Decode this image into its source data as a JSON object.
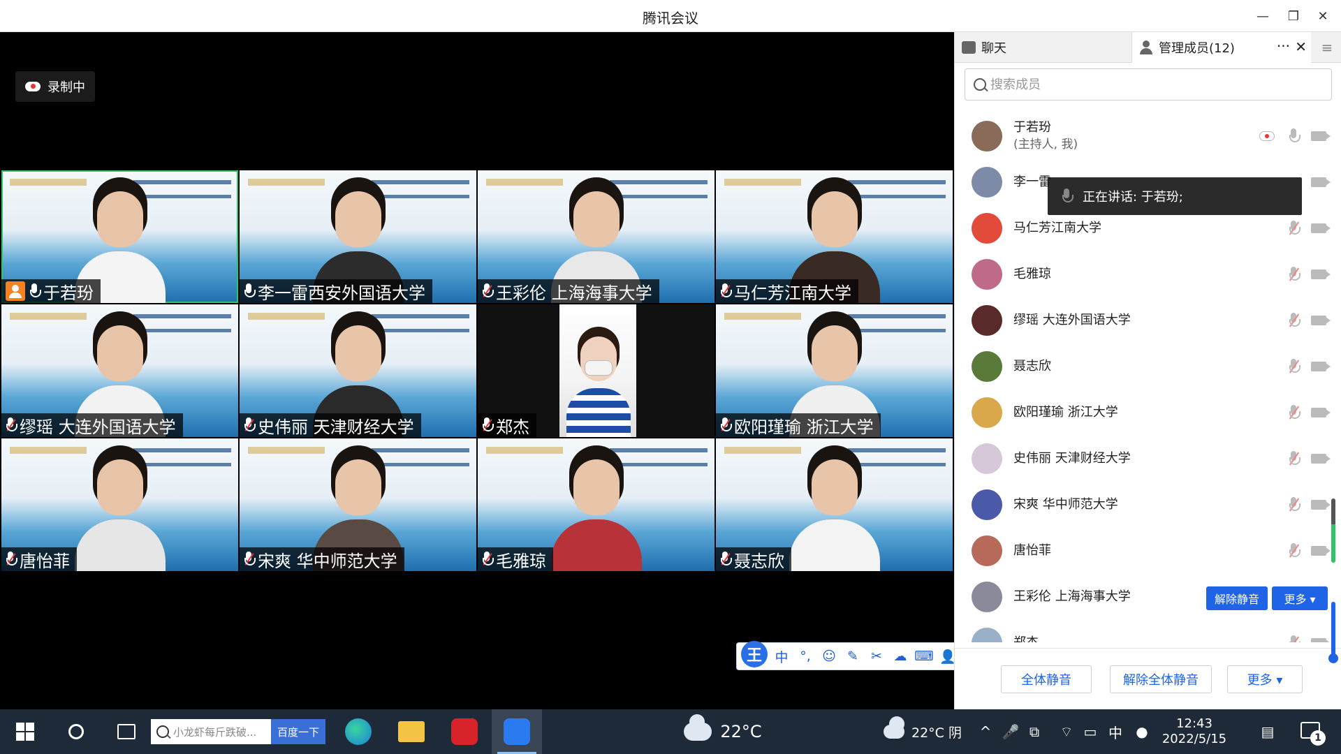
{
  "window": {
    "title": "腾讯会议",
    "minimize": "—",
    "restore": "❐",
    "close": "✕"
  },
  "recording": {
    "label": "录制中"
  },
  "tiles": [
    {
      "name": "于若玢",
      "muted": false,
      "host": true
    },
    {
      "name": "李一雷西安外国语大学",
      "muted": false,
      "host": false
    },
    {
      "name": "王彩伦 上海海事大学",
      "muted": true,
      "host": false
    },
    {
      "name": "马仁芳江南大学",
      "muted": true,
      "host": false
    },
    {
      "name": "缪瑶 大连外国语大学",
      "muted": true,
      "host": false
    },
    {
      "name": "史伟丽 天津财经大学",
      "muted": true,
      "host": false
    },
    {
      "name": "郑杰",
      "muted": true,
      "host": false
    },
    {
      "name": "欧阳瑾瑜 浙江大学",
      "muted": true,
      "host": false
    },
    {
      "name": "唐怡菲",
      "muted": true,
      "host": false
    },
    {
      "name": "宋爽 华中师范大学",
      "muted": true,
      "host": false
    },
    {
      "name": "毛雅琼",
      "muted": true,
      "host": false
    },
    {
      "name": "聂志欣",
      "muted": true,
      "host": false
    }
  ],
  "ime": {
    "logo": "王",
    "mode": "中",
    "punct": "°,",
    "emoji": "☺",
    "pen": "✎",
    "scissors": "✂",
    "cloud": "☁",
    "keyboard": "⌨",
    "user": "👤",
    "skin": "👕",
    "settings": "⚙"
  },
  "sidebar": {
    "chat_tab": "聊天",
    "members_tab": "管理成员(12)",
    "more": "···",
    "close": "✕",
    "menu": "≡",
    "search_placeholder": "搜索成员",
    "members": [
      {
        "name": "于若玢",
        "sub": "(主持人, 我)",
        "color": "#8a6a58"
      },
      {
        "name": "李一雷",
        "sub": "",
        "color": "#7d8aa8"
      },
      {
        "name": "马仁芳江南大学",
        "sub": "",
        "color": "#e24a3a"
      },
      {
        "name": "毛雅琼",
        "sub": "",
        "color": "#c06a8a"
      },
      {
        "name": "缪瑶 大连外国语大学",
        "sub": "",
        "color": "#5a2a2a"
      },
      {
        "name": "聂志欣",
        "sub": "",
        "color": "#5a7a3a"
      },
      {
        "name": "欧阳瑾瑜 浙江大学",
        "sub": "",
        "color": "#d9a84a"
      },
      {
        "name": "史伟丽 天津财经大学",
        "sub": "",
        "color": "#d6c8d8"
      },
      {
        "name": "宋爽 华中师范大学",
        "sub": "",
        "color": "#4a5aa8"
      },
      {
        "name": "唐怡菲",
        "sub": "",
        "color": "#b86a5a"
      },
      {
        "name": "王彩伦 上海海事大学",
        "sub": "",
        "color": "#8a8a9a"
      },
      {
        "name": "郑杰",
        "sub": "",
        "color": "#9ab0c8"
      }
    ],
    "row_unmute": "解除静音",
    "row_more": "更多 ▾",
    "speaking": "正在讲话: 于若玢;",
    "footer": {
      "mute_all": "全体静音",
      "unmute_all": "解除全体静音",
      "more": "更多 ▾"
    }
  },
  "taskbar": {
    "search_placeholder": "小龙虾每斤跌破...",
    "search_button": "百度一下",
    "weather_center": "22°C",
    "weather_tray": "22°C 阴",
    "ime": "中",
    "time": "12:43",
    "date": "2022/5/15",
    "notifications": "1"
  }
}
